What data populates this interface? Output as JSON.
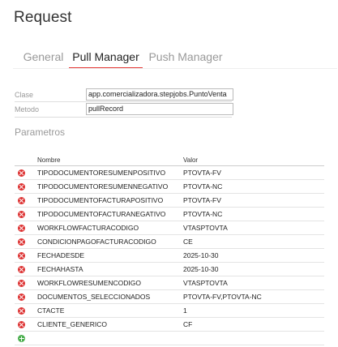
{
  "page": {
    "title": "Request"
  },
  "tabs": [
    {
      "label": "General",
      "active": false
    },
    {
      "label": "Pull Manager",
      "active": true
    },
    {
      "label": "Push Manager",
      "active": false
    }
  ],
  "form": {
    "clase_label": "Clase",
    "clase_value": "app.comercializadora.stepjobs.PuntoVenta",
    "metodo_label": "Metodo",
    "metodo_value": "pullRecord"
  },
  "parametros": {
    "section_title": "Parametros",
    "columns": [
      "Nombre",
      "Valor"
    ],
    "rows": [
      {
        "nombre": "TIPODOCUMENTORESUMENPOSITIVO",
        "valor": "PTOVTA-FV"
      },
      {
        "nombre": "TIPODOCUMENTORESUMENNEGATIVO",
        "valor": "PTOVTA-NC"
      },
      {
        "nombre": "TIPODOCUMENTOFACTURAPOSITIVO",
        "valor": "PTOVTA-FV"
      },
      {
        "nombre": "TIPODOCUMENTOFACTURANEGATIVO",
        "valor": "PTOVTA-NC"
      },
      {
        "nombre": "WORKFLOWFACTURACODIGO",
        "valor": "VTASPTOVTA"
      },
      {
        "nombre": "CONDICIONPAGOFACTURACODIGO",
        "valor": "CE"
      },
      {
        "nombre": "FECHADESDE",
        "valor": "2025-10-30"
      },
      {
        "nombre": "FECHAHASTA",
        "valor": "2025-10-30"
      },
      {
        "nombre": "WORKFLOWRESUMENCODIGO",
        "valor": "VTASPTOVTA"
      },
      {
        "nombre": "DOCUMENTOS_SELECCIONADOS",
        "valor": "PTOVTA-FV,PTOVTA-NC"
      },
      {
        "nombre": "CTACTE",
        "valor": "1"
      },
      {
        "nombre": "CLIENTE_GENERICO",
        "valor": "CF"
      }
    ]
  },
  "colors": {
    "accent": "#e53935",
    "delete": "#dd3333",
    "add": "#4caf50"
  },
  "icons": {
    "row_delete": "remove-circle-icon",
    "row_add": "add-circle-icon"
  }
}
